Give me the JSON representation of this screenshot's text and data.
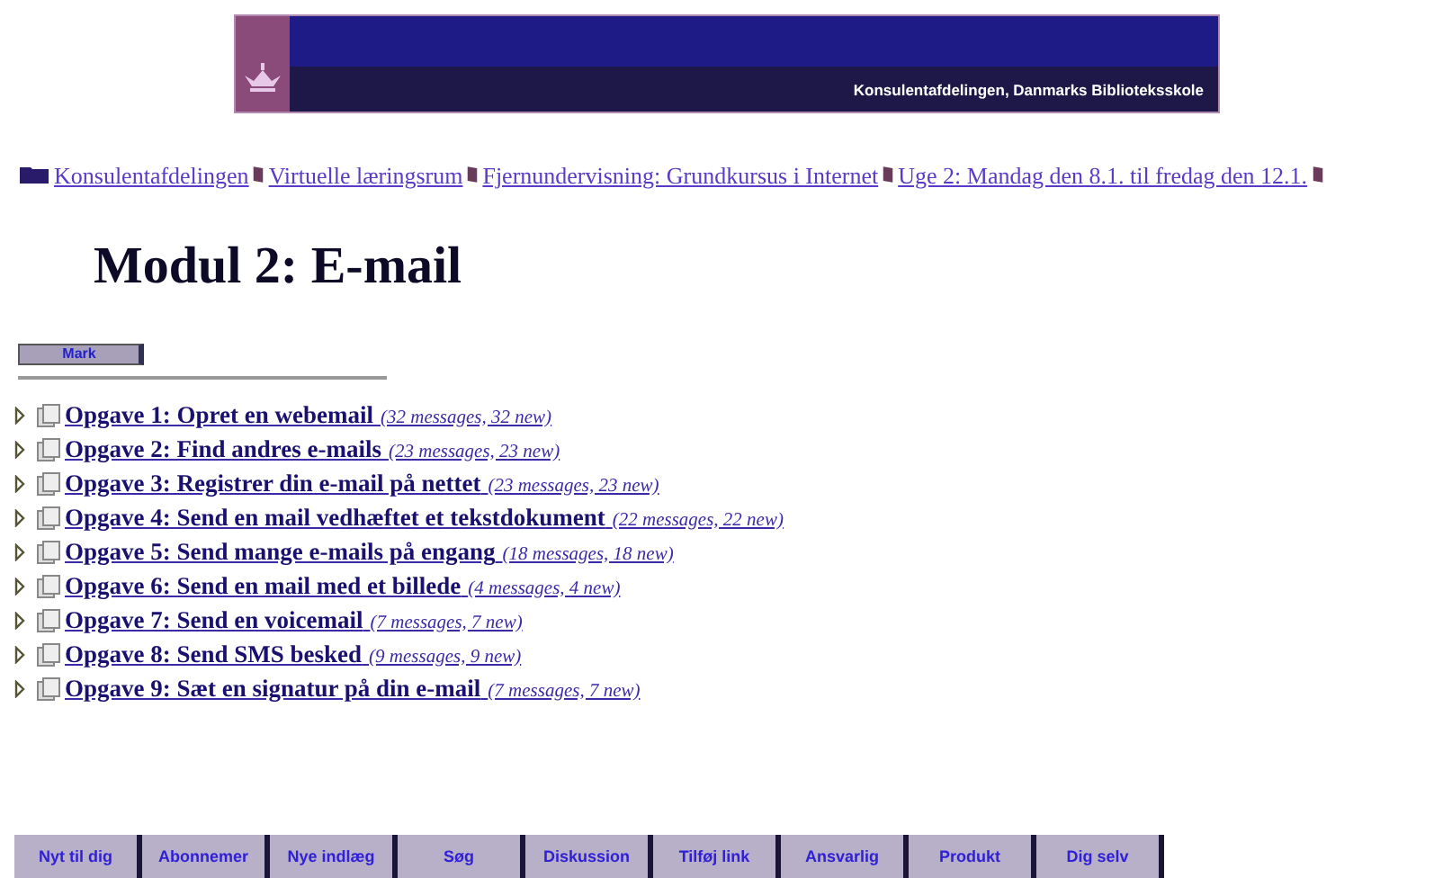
{
  "banner": {
    "text": "Konsulentafdelingen, Danmarks Biblioteksskole"
  },
  "breadcrumb": [
    {
      "label": "Konsulentafdelingen",
      "kind": "folder"
    },
    {
      "label": "Virtuelle læringsrum",
      "kind": "book"
    },
    {
      "label": "Fjernundervisning: Grundkursus i Internet",
      "kind": "book"
    },
    {
      "label": "Uge 2: Mandag den 8.1. til fredag den 12.1.",
      "kind": "book"
    }
  ],
  "title": "Modul 2: E-mail",
  "mark_button": "Mark",
  "topics": [
    {
      "title": "Opgave 1: Opret en webemail",
      "count": "(32 messages, 32 new)"
    },
    {
      "title": "Opgave 2: Find andres e-mails",
      "count": "(23 messages, 23 new)"
    },
    {
      "title": "Opgave 3: Registrer din e-mail på nettet",
      "count": "(23 messages, 23 new)"
    },
    {
      "title": "Opgave 4: Send en mail vedhæftet et tekstdokument",
      "count": "(22 messages, 22 new)"
    },
    {
      "title": "Opgave 5: Send mange e-mails på engang",
      "count": "(18 messages, 18 new)"
    },
    {
      "title": "Opgave 6: Send en mail med et billede",
      "count": "(4 messages, 4 new)"
    },
    {
      "title": "Opgave 7: Send en voicemail",
      "count": "(7 messages, 7 new)"
    },
    {
      "title": "Opgave 8: Send SMS besked",
      "count": "(9 messages, 9 new)"
    },
    {
      "title": "Opgave 9: Sæt en signatur på din e-mail",
      "count": "(7 messages, 7 new)"
    }
  ],
  "nav_buttons": [
    "Nyt til dig",
    "Abonnemer",
    "Nye indlæg",
    "Søg",
    "Diskussion",
    "Tilføj link",
    "Ansvarlig",
    "Produkt",
    "Dig selv"
  ]
}
